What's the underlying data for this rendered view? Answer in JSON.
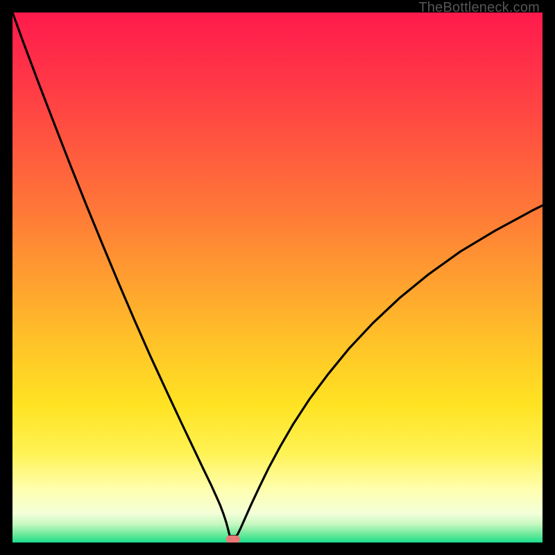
{
  "watermark": "TheBottleneck.com",
  "chart_data": {
    "type": "line",
    "title": "",
    "xlabel": "",
    "ylabel": "",
    "xlim": [
      0,
      100
    ],
    "ylim": [
      0,
      100
    ],
    "grid": false,
    "legend": false,
    "series": [
      {
        "name": "bottleneck-curve",
        "x": [
          0,
          2,
          5,
          8,
          11,
          14,
          17,
          20,
          23,
          26,
          29,
          32,
          34,
          36,
          37.5,
          38.5,
          39.2,
          39.8,
          40.3,
          40.7,
          41.0,
          42.2,
          42.5,
          43.0,
          43.8,
          45.0,
          46.5,
          48.3,
          50.5,
          53.0,
          56.0,
          59.5,
          63.5,
          68.0,
          73.0,
          78.5,
          84.5,
          91.0,
          98.0,
          100.0
        ],
        "y": [
          100,
          94.5,
          86.5,
          78.7,
          71.0,
          63.5,
          56.2,
          49.0,
          42.0,
          35.2,
          28.7,
          22.3,
          18.1,
          13.9,
          10.8,
          8.6,
          7.0,
          5.4,
          3.9,
          2.4,
          1.2,
          1.2,
          1.6,
          2.6,
          4.4,
          7.1,
          10.3,
          14.0,
          18.1,
          22.4,
          27.0,
          31.7,
          36.6,
          41.4,
          46.1,
          50.6,
          54.9,
          58.8,
          62.6,
          63.6
        ]
      }
    ],
    "marker": {
      "x": 41.6,
      "y": 0.6,
      "color": "#e77a78"
    },
    "gradient_stops": [
      {
        "offset": 0.0,
        "color": "#ff1a4c"
      },
      {
        "offset": 0.12,
        "color": "#ff3547"
      },
      {
        "offset": 0.25,
        "color": "#ff573f"
      },
      {
        "offset": 0.38,
        "color": "#ff7a37"
      },
      {
        "offset": 0.5,
        "color": "#ff9e30"
      },
      {
        "offset": 0.62,
        "color": "#ffc228"
      },
      {
        "offset": 0.74,
        "color": "#ffe323"
      },
      {
        "offset": 0.83,
        "color": "#fff253"
      },
      {
        "offset": 0.9,
        "color": "#ffffaf"
      },
      {
        "offset": 0.945,
        "color": "#f3ffd8"
      },
      {
        "offset": 0.965,
        "color": "#c7f8c1"
      },
      {
        "offset": 0.985,
        "color": "#6ae99a"
      },
      {
        "offset": 1.0,
        "color": "#19dd8c"
      }
    ]
  }
}
